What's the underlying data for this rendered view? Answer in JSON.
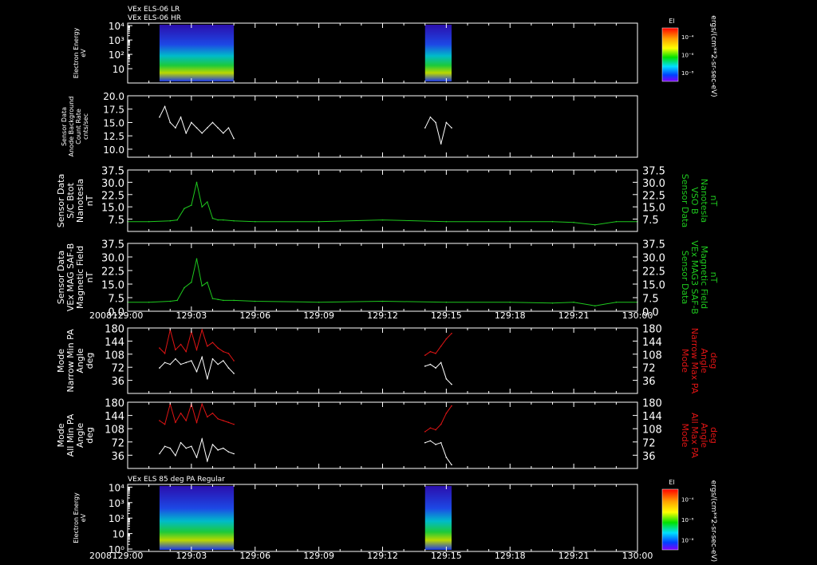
{
  "colors": {
    "background": "#000000",
    "axes": "#ffffff",
    "white": "#ffffff",
    "green": "#1ec81e",
    "red": "#e01414"
  },
  "chart_data": [
    {
      "type": "heatmap",
      "id": "p1",
      "title_lines": [
        "VEx ELS-06 LR",
        "VEx ELS-06 HR"
      ],
      "ylabel": [
        "Electron Energy",
        "eV"
      ],
      "yscale": "log",
      "yticks": [
        "10",
        "10²",
        "10³",
        "10⁴"
      ],
      "ylim": [
        1,
        15000
      ],
      "colorbar": {
        "label": "El",
        "ticks": [
          "10⁻⁴",
          "10⁻⁶",
          "10⁻⁸"
        ],
        "units": "ergs/(cm**2-sr-sec-eV)"
      },
      "data_intervals": [
        [
          "129:01:30",
          "129:05:00"
        ],
        [
          "129:14:00",
          "129:15:15"
        ]
      ]
    },
    {
      "type": "line",
      "id": "p2",
      "ylabel": [
        "Sensor Data",
        "Anode Background",
        "Count Rate",
        "cnts/sec"
      ],
      "ylim": [
        8.5,
        20
      ],
      "yticks": [
        "10.0",
        "12.5",
        "15.0",
        "17.5",
        "20.0"
      ],
      "series": [
        {
          "color": "white",
          "x": [
            "129:01:30",
            "129:01:45",
            "129:02:00",
            "129:02:15",
            "129:02:30",
            "129:02:45",
            "129:03:00",
            "129:03:15",
            "129:03:30",
            "129:03:45",
            "129:04:00",
            "129:04:15",
            "129:04:30",
            "129:04:45",
            "129:05:00"
          ],
          "values": [
            16,
            18,
            15,
            14,
            16,
            13,
            15,
            14,
            13,
            14,
            15,
            14,
            13,
            14,
            12
          ]
        },
        {
          "color": "white",
          "x": [
            "129:14:00",
            "129:14:15",
            "129:14:30",
            "129:14:45",
            "129:15:00",
            "129:15:15"
          ],
          "values": [
            14,
            16,
            15,
            11,
            15,
            14
          ]
        }
      ]
    },
    {
      "type": "line",
      "id": "p3",
      "ylabel": [
        "Sensor Data",
        "S/C Btot",
        "Nanotesla",
        "nT"
      ],
      "ylabel_right": [
        "Sensor Data",
        "VSO B",
        "Nanotesla",
        "nT"
      ],
      "ylim": [
        0,
        37.5
      ],
      "yticks": [
        "7.5",
        "15.0",
        "22.5",
        "30.0",
        "37.5"
      ],
      "series": [
        {
          "color": "green",
          "x": [
            "129:00:00",
            "129:01:00",
            "129:02:00",
            "129:02:20",
            "129:02:40",
            "129:03:00",
            "129:03:15",
            "129:03:30",
            "129:03:45",
            "129:04:00",
            "129:04:15",
            "129:04:30",
            "129:05:00",
            "129:06:00",
            "129:09:00",
            "129:12:00",
            "129:15:00",
            "129:18:00",
            "129:20:00",
            "129:21:00",
            "129:22:00",
            "129:23:00",
            "129:24:00"
          ],
          "values": [
            6,
            6,
            6.5,
            7,
            14,
            16,
            30,
            15,
            18,
            8,
            7,
            7,
            6.5,
            6,
            6,
            7,
            6,
            6,
            6,
            5.5,
            4,
            6,
            6
          ]
        }
      ]
    },
    {
      "type": "line",
      "id": "p4",
      "ylabel": [
        "Sensor Data",
        "VEx MAG SAF-B",
        "Magnetic Field",
        "nT"
      ],
      "ylabel_right": [
        "Sensor Data",
        "VEx MAG3 SAF-B",
        "Magnetic Field",
        "nT"
      ],
      "ylim": [
        0,
        37.5
      ],
      "yticks": [
        "0.0",
        "7.5",
        "15.0",
        "22.5",
        "30.0",
        "37.5"
      ],
      "xaxis_year": "2008",
      "xticks": [
        "129:00",
        "129:03",
        "129:06",
        "129:09",
        "129:12",
        "129:15",
        "129:18",
        "129:21",
        "130:00"
      ],
      "series": [
        {
          "color": "green",
          "x": [
            "129:00:00",
            "129:01:00",
            "129:02:00",
            "129:02:20",
            "129:02:40",
            "129:03:00",
            "129:03:15",
            "129:03:30",
            "129:03:45",
            "129:04:00",
            "129:04:15",
            "129:04:30",
            "129:05:00",
            "129:06:00",
            "129:09:00",
            "129:12:00",
            "129:15:00",
            "129:18:00",
            "129:20:00",
            "129:21:00",
            "129:22:00",
            "129:23:00",
            "129:24:00"
          ],
          "values": [
            5,
            5,
            5.5,
            6,
            13,
            16,
            29,
            14,
            16,
            7,
            6.5,
            6,
            6,
            5.5,
            5,
            5.5,
            5,
            5,
            4.5,
            5,
            3,
            5,
            5
          ]
        }
      ]
    },
    {
      "type": "line",
      "id": "p5",
      "ylabel": [
        "Mode",
        "Narrow Min PA",
        "Angle",
        "deg"
      ],
      "ylabel_right": [
        "Mode",
        "Narrow Max PA",
        "Angle",
        "deg"
      ],
      "ylim": [
        0,
        180
      ],
      "yticks": [
        "36",
        "72",
        "108",
        "144",
        "180"
      ],
      "series": [
        {
          "color": "white",
          "x": [
            "129:01:30",
            "129:01:45",
            "129:02:00",
            "129:02:15",
            "129:02:30",
            "129:02:45",
            "129:03:00",
            "129:03:15",
            "129:03:30",
            "129:03:45",
            "129:04:00",
            "129:04:15",
            "129:04:30",
            "129:04:45",
            "129:05:00"
          ],
          "values": [
            70,
            85,
            80,
            95,
            80,
            85,
            90,
            60,
            100,
            40,
            95,
            80,
            90,
            70,
            55
          ]
        },
        {
          "color": "white",
          "x": [
            "129:14:00",
            "129:14:15",
            "129:14:30",
            "129:14:45",
            "129:15:00",
            "129:15:15"
          ],
          "values": [
            75,
            80,
            70,
            85,
            40,
            25
          ]
        },
        {
          "color": "red",
          "x": [
            "129:01:30",
            "129:01:45",
            "129:02:00",
            "129:02:15",
            "129:02:30",
            "129:02:45",
            "129:03:00",
            "129:03:15",
            "129:03:30",
            "129:03:45",
            "129:04:00",
            "129:04:15",
            "129:04:30",
            "129:04:45",
            "129:05:00"
          ],
          "values": [
            125,
            110,
            175,
            120,
            135,
            115,
            170,
            120,
            175,
            130,
            140,
            125,
            115,
            110,
            90
          ]
        },
        {
          "color": "red",
          "x": [
            "129:14:00",
            "129:14:15",
            "129:14:30",
            "129:14:45",
            "129:15:00",
            "129:15:15"
          ],
          "values": [
            105,
            115,
            110,
            130,
            150,
            165
          ]
        }
      ]
    },
    {
      "type": "line",
      "id": "p6",
      "ylabel": [
        "Mode",
        "All Min PA",
        "Angle",
        "deg"
      ],
      "ylabel_right": [
        "Mode",
        "All Max PA",
        "Angle",
        "deg"
      ],
      "ylim": [
        0,
        180
      ],
      "yticks": [
        "36",
        "72",
        "108",
        "144",
        "180"
      ],
      "series": [
        {
          "color": "white",
          "x": [
            "129:01:30",
            "129:01:45",
            "129:02:00",
            "129:02:15",
            "129:02:30",
            "129:02:45",
            "129:03:00",
            "129:03:15",
            "129:03:30",
            "129:03:45",
            "129:04:00",
            "129:04:15",
            "129:04:30",
            "129:04:45",
            "129:05:00"
          ],
          "values": [
            40,
            60,
            55,
            35,
            70,
            55,
            60,
            30,
            80,
            20,
            65,
            50,
            55,
            45,
            40
          ]
        },
        {
          "color": "white",
          "x": [
            "129:14:00",
            "129:14:15",
            "129:14:30",
            "129:14:45",
            "129:15:00",
            "129:15:15"
          ],
          "values": [
            70,
            75,
            65,
            70,
            30,
            10
          ]
        },
        {
          "color": "red",
          "x": [
            "129:01:30",
            "129:01:45",
            "129:02:00",
            "129:02:15",
            "129:02:30",
            "129:02:45",
            "129:03:00",
            "129:03:15",
            "129:03:30",
            "129:03:45",
            "129:04:00",
            "129:04:15",
            "129:04:30",
            "129:04:45",
            "129:05:00"
          ],
          "values": [
            130,
            120,
            175,
            125,
            150,
            130,
            175,
            125,
            175,
            140,
            150,
            135,
            130,
            125,
            120
          ]
        },
        {
          "color": "red",
          "x": [
            "129:14:00",
            "129:14:15",
            "129:14:30",
            "129:14:45",
            "129:15:00",
            "129:15:15"
          ],
          "values": [
            100,
            110,
            105,
            120,
            150,
            170
          ]
        }
      ]
    },
    {
      "type": "heatmap",
      "id": "p7",
      "title_lines": [
        "VEx ELS 85 deg PA Regular"
      ],
      "ylabel": [
        "Electron Energy",
        "eV"
      ],
      "yscale": "log",
      "yticks": [
        "10⁰",
        "10",
        "10²",
        "10³",
        "10⁴"
      ],
      "ylim": [
        0.7,
        15000
      ],
      "colorbar": {
        "label": "El",
        "ticks": [
          "10⁻⁴",
          "10⁻⁶",
          "10⁻⁸"
        ],
        "units": "ergs/(cm**2-sr-sec-eV)"
      },
      "xaxis_year": "2008",
      "xticks": [
        "129:00",
        "129:03",
        "129:06",
        "129:09",
        "129:12",
        "129:15",
        "129:18",
        "129:21",
        "130:00"
      ],
      "data_intervals": [
        [
          "129:01:30",
          "129:05:00"
        ],
        [
          "129:14:00",
          "129:15:15"
        ]
      ]
    }
  ]
}
